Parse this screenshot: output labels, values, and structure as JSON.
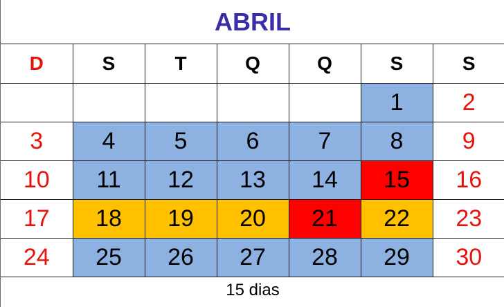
{
  "title": "ABRIL",
  "weekdays": [
    "D",
    "S",
    "T",
    "Q",
    "Q",
    "S",
    "S"
  ],
  "weeks": [
    [
      {
        "day": "",
        "style": "empty"
      },
      {
        "day": "",
        "style": "empty"
      },
      {
        "day": "",
        "style": "empty"
      },
      {
        "day": "",
        "style": "empty"
      },
      {
        "day": "",
        "style": "empty"
      },
      {
        "day": "1",
        "style": "blue"
      },
      {
        "day": "2",
        "style": "sunday"
      }
    ],
    [
      {
        "day": "3",
        "style": "sunday"
      },
      {
        "day": "4",
        "style": "blue"
      },
      {
        "day": "5",
        "style": "blue"
      },
      {
        "day": "6",
        "style": "blue"
      },
      {
        "day": "7",
        "style": "blue"
      },
      {
        "day": "8",
        "style": "blue"
      },
      {
        "day": "9",
        "style": "sunday"
      }
    ],
    [
      {
        "day": "10",
        "style": "sunday"
      },
      {
        "day": "11",
        "style": "blue"
      },
      {
        "day": "12",
        "style": "blue"
      },
      {
        "day": "13",
        "style": "blue"
      },
      {
        "day": "14",
        "style": "blue"
      },
      {
        "day": "15",
        "style": "red"
      },
      {
        "day": "16",
        "style": "sunday"
      }
    ],
    [
      {
        "day": "17",
        "style": "sunday"
      },
      {
        "day": "18",
        "style": "orange"
      },
      {
        "day": "19",
        "style": "orange"
      },
      {
        "day": "20",
        "style": "orange"
      },
      {
        "day": "21",
        "style": "red"
      },
      {
        "day": "22",
        "style": "orange"
      },
      {
        "day": "23",
        "style": "sunday"
      }
    ],
    [
      {
        "day": "24",
        "style": "sunday"
      },
      {
        "day": "25",
        "style": "blue"
      },
      {
        "day": "26",
        "style": "blue"
      },
      {
        "day": "27",
        "style": "blue"
      },
      {
        "day": "28",
        "style": "blue"
      },
      {
        "day": "29",
        "style": "blue"
      },
      {
        "day": "30",
        "style": "sunday"
      }
    ]
  ],
  "footer": "15 dias",
  "colors": {
    "title": "#3a2ea8",
    "sunday_text": "#e8140c",
    "blue_cell": "#8db2e2",
    "orange_cell": "#ffc000",
    "red_cell": "#ff0000"
  }
}
